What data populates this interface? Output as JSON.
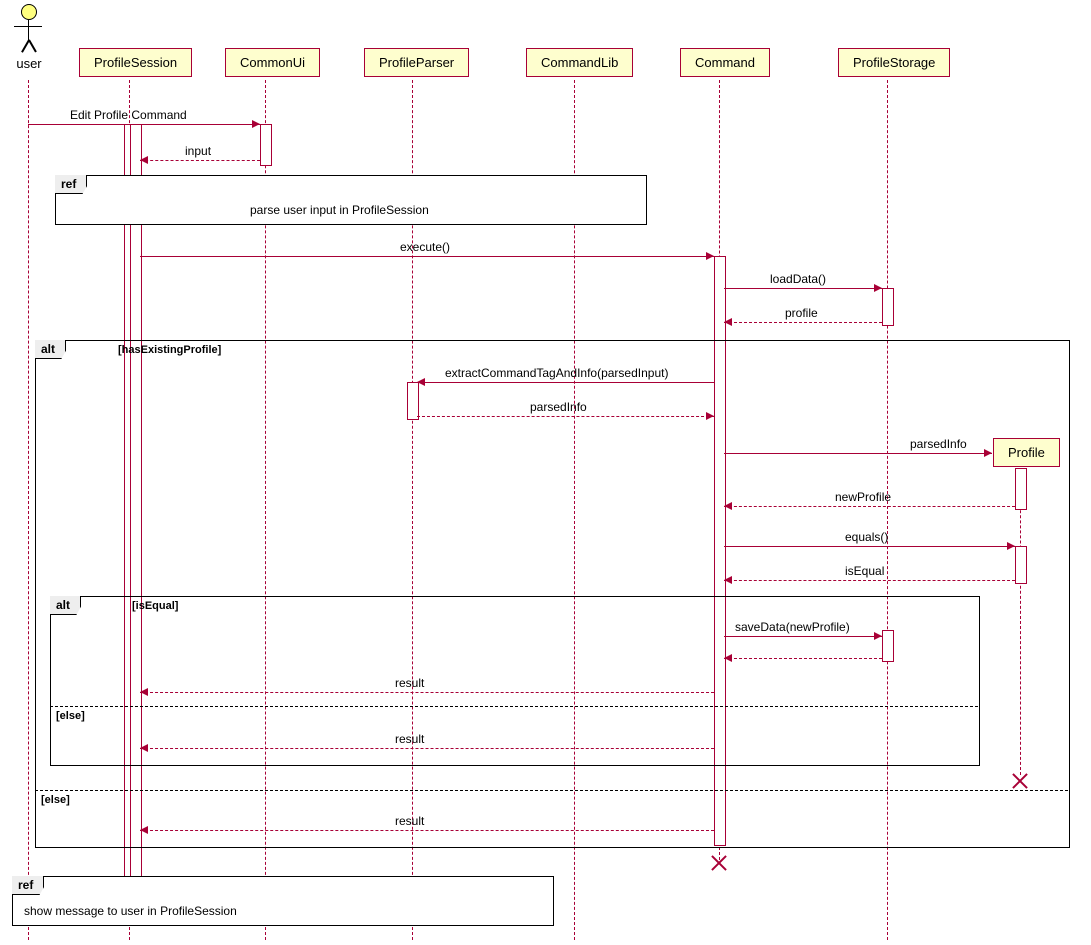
{
  "actor": {
    "name": "user"
  },
  "participants": {
    "profileSession": "ProfileSession",
    "commonUi": "CommonUi",
    "profileParser": "ProfileParser",
    "commandLib": "CommandLib",
    "command": "Command",
    "profileStorage": "ProfileStorage",
    "profile": "Profile"
  },
  "messages": {
    "editProfileCommand": "Edit Profile Command",
    "input": "input",
    "execute": "execute()",
    "loadData": "loadData()",
    "profileReturn": "profile",
    "extractCmd": "extractCommandTagAndInfo(parsedInput)",
    "parsedInfoRet": "parsedInfo",
    "parsedInfoNew": "parsedInfo",
    "newProfile": "newProfile",
    "equals": "equals()",
    "isEqual": "isEqual",
    "saveData": "saveData(newProfile)",
    "result": "result"
  },
  "frames": {
    "ref1": {
      "label": "ref",
      "text": "parse user input in ProfileSession"
    },
    "alt1": {
      "label": "alt",
      "guard1": "[hasExistingProfile]",
      "guard2": "[else]"
    },
    "alt2": {
      "label": "alt",
      "guard1": "[isEqual]",
      "guard2": "[else]"
    },
    "ref2": {
      "label": "ref",
      "text": "show message to user in ProfileSession"
    }
  }
}
